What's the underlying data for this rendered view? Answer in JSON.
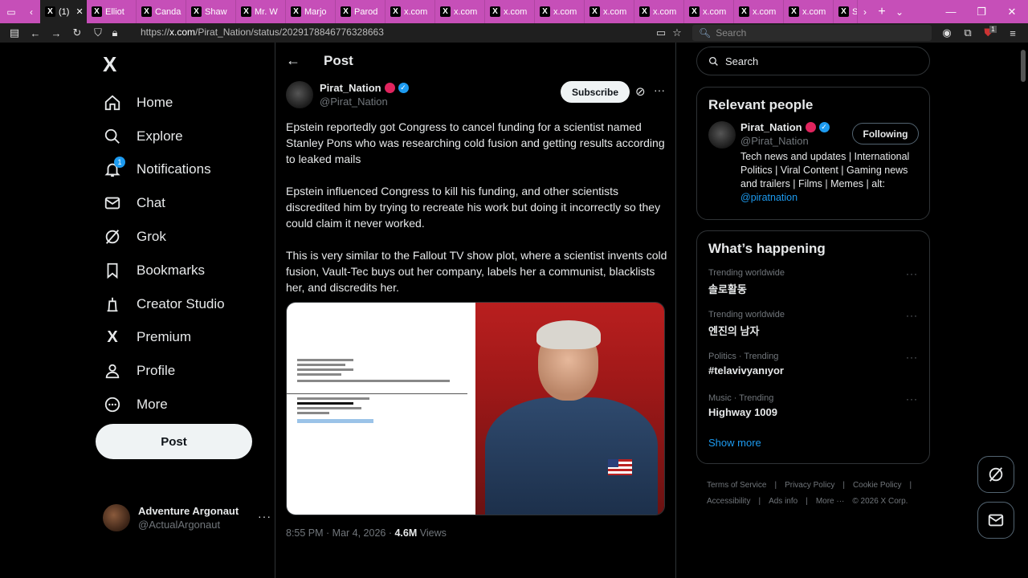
{
  "browser": {
    "tabs": [
      {
        "label": "(1)",
        "active": true
      },
      {
        "label": "Elliot"
      },
      {
        "label": "Canda"
      },
      {
        "label": "Shaw"
      },
      {
        "label": "Mr. W"
      },
      {
        "label": "Marjo"
      },
      {
        "label": "Parod"
      },
      {
        "label": "x.com"
      },
      {
        "label": "x.com"
      },
      {
        "label": "x.com"
      },
      {
        "label": "x.com"
      },
      {
        "label": "x.com"
      },
      {
        "label": "x.com"
      },
      {
        "label": "x.com"
      },
      {
        "label": "x.com"
      },
      {
        "label": "x.com"
      },
      {
        "label": "S"
      }
    ],
    "url_prefix": "https://",
    "url_host": "x.com",
    "url_path": "/Pirat_Nation/status/2029178846776328663",
    "search_placeholder": "Search",
    "extension_badge": "1",
    "accent_color": "#c64fb8"
  },
  "sidebar": {
    "logo": "X",
    "items": [
      {
        "label": "Home",
        "icon": "home-icon"
      },
      {
        "label": "Explore",
        "icon": "search-icon"
      },
      {
        "label": "Notifications",
        "icon": "bell-icon",
        "badge": "1"
      },
      {
        "label": "Chat",
        "icon": "mail-icon"
      },
      {
        "label": "Grok",
        "icon": "grok-icon"
      },
      {
        "label": "Bookmarks",
        "icon": "bookmark-icon"
      },
      {
        "label": "Creator Studio",
        "icon": "creator-icon"
      },
      {
        "label": "Premium",
        "icon": "x-icon"
      },
      {
        "label": "Profile",
        "icon": "person-icon"
      },
      {
        "label": "More",
        "icon": "more-circle-icon"
      }
    ],
    "post_label": "Post",
    "account": {
      "name": "Adventure Argonaut",
      "handle": "@ActualArgonaut"
    }
  },
  "main": {
    "title": "Post",
    "author": {
      "name": "Pirat_Nation",
      "handle": "@Pirat_Nation"
    },
    "subscribe_label": "Subscribe",
    "paragraphs": [
      "Epstein reportedly got Congress to cancel funding for a scientist named Stanley Pons who was researching cold fusion and getting results according to leaked mails",
      "Epstein influenced Congress to kill his funding, and other scientists discredited him by trying to recreate his work but doing it incorrectly so they could claim it never worked.",
      "This is very similar to the Fallout TV show plot, where a scientist invents cold fusion, Vault-Tec buys out her company, labels her a communist, blacklists her, and discredits her."
    ],
    "time": "8:55 PM · Mar 4, 2026 · ",
    "views_count": "4.6M",
    "views_label": " Views"
  },
  "right": {
    "search_placeholder": "Search",
    "relevant_title": "Relevant people",
    "relevant_person": {
      "name": "Pirat_Nation",
      "handle": "@Pirat_Nation",
      "button": "Following",
      "bio": "Tech news and updates | International Politics | Viral Content | Gaming news and trailers | Films | Memes | alt: ",
      "bio_link": "@piratnation"
    },
    "happening_title": "What’s happening",
    "trends": [
      {
        "meta": "Trending worldwide",
        "name": "솔로활동"
      },
      {
        "meta": "Trending worldwide",
        "name": "엔진의 남자"
      },
      {
        "meta": "Politics · Trending",
        "name": "#telavivyanıyor"
      },
      {
        "meta": "Music · Trending",
        "name": "Highway 1009"
      }
    ],
    "show_more": "Show more",
    "footer": [
      "Terms of Service",
      "|",
      "Privacy Policy",
      "|",
      "Cookie Policy",
      "|",
      "Accessibility",
      "|",
      "Ads info",
      "|",
      "More ···",
      "© 2026 X Corp."
    ]
  }
}
